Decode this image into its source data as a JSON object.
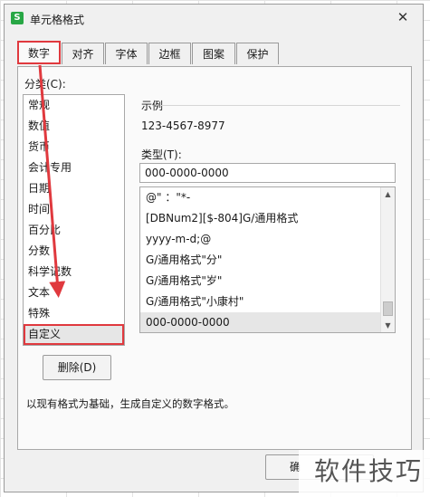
{
  "window": {
    "title": "单元格格式",
    "app_icon_letter": "S",
    "close": "✕"
  },
  "tabs": [
    {
      "label": "数字",
      "active": true
    },
    {
      "label": "对齐"
    },
    {
      "label": "字体"
    },
    {
      "label": "边框"
    },
    {
      "label": "图案"
    },
    {
      "label": "保护"
    }
  ],
  "category": {
    "label": "分类(C):",
    "items": [
      "常规",
      "数值",
      "货币",
      "会计专用",
      "日期",
      "时间",
      "百分比",
      "分数",
      "科学记数",
      "文本",
      "特殊",
      "自定义"
    ],
    "selected": "自定义"
  },
  "sample": {
    "label": "示例",
    "value": "123-4567-8977"
  },
  "type": {
    "label": "类型(T):",
    "value": "000-0000-0000",
    "list": [
      "@\" ：\"*-",
      "[DBNum2][$-804]G/通用格式",
      "yyyy-m-d;@",
      "G/通用格式\"分\"",
      "G/通用格式\"岁\"",
      "G/通用格式\"小康村\"",
      "000-0000-0000"
    ],
    "selected": "000-0000-0000"
  },
  "buttons": {
    "delete": "删除(D)",
    "ok": "确"
  },
  "description": "以现有格式为基础，生成自定义的数字格式。",
  "watermark": "软件技巧",
  "colors": {
    "highlight": "#e0393e",
    "selection": "#e6e6e6",
    "app_icon": "#28a745"
  }
}
